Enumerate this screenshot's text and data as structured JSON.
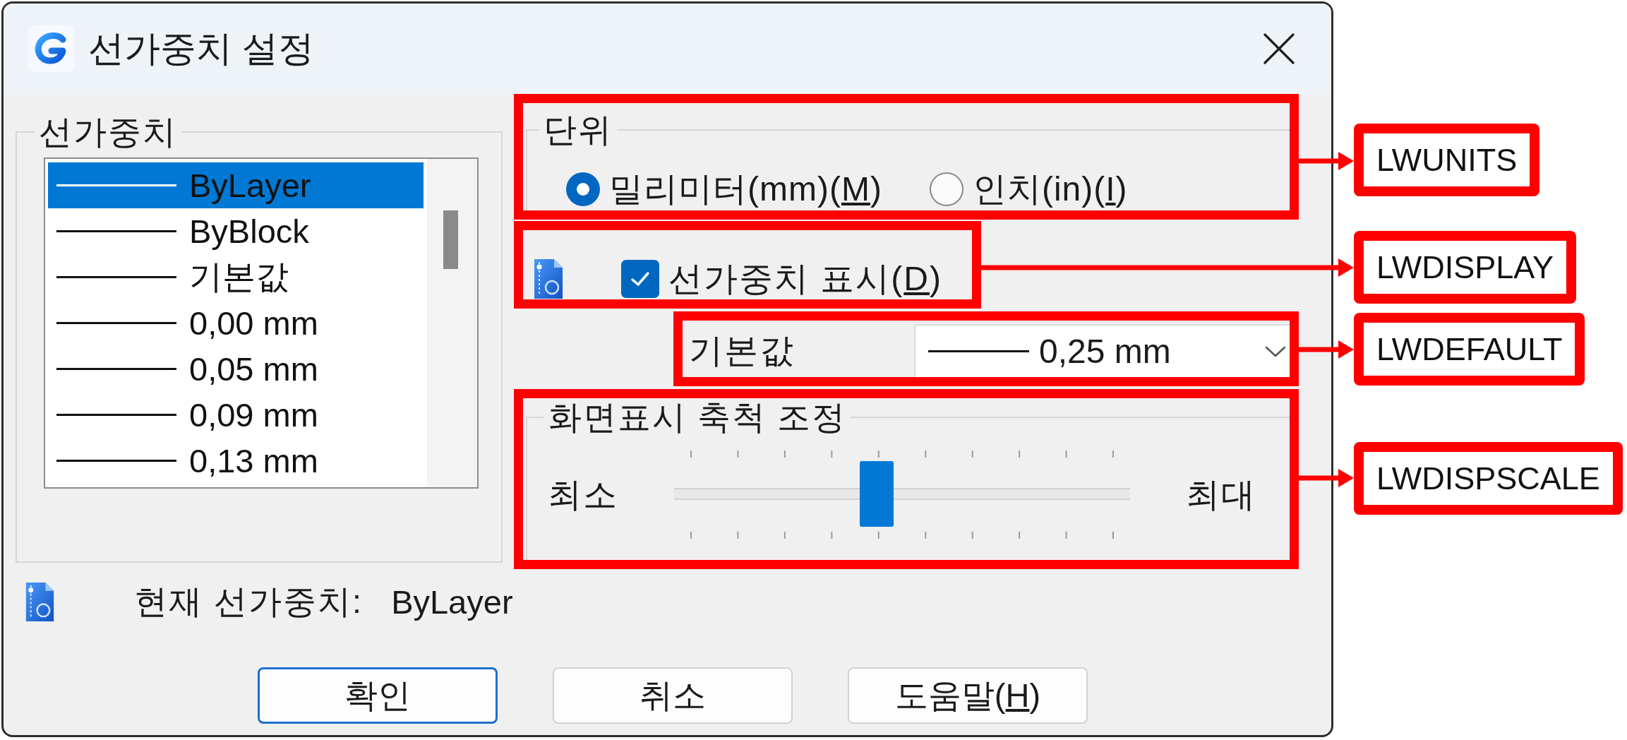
{
  "window": {
    "title": "선가중치 설정"
  },
  "lineweights": {
    "label": "선가중치",
    "items": [
      {
        "text": "ByLayer",
        "selected": true
      },
      {
        "text": "ByBlock",
        "selected": false
      },
      {
        "text": "기본값",
        "selected": false
      },
      {
        "text": "0,00 mm",
        "selected": false
      },
      {
        "text": "0,05 mm",
        "selected": false
      },
      {
        "text": "0,09 mm",
        "selected": false
      },
      {
        "text": "0,13 mm",
        "selected": false
      }
    ]
  },
  "units": {
    "label": "단위",
    "options": [
      {
        "label": {
          "text": "밀리미터(mm)(",
          "access_key": "M",
          "text_after": ")"
        },
        "selected": true
      },
      {
        "label": {
          "text": "인치(in)(",
          "access_key": "I",
          "text_after": ")"
        },
        "selected": false
      }
    ]
  },
  "display_lineweight": {
    "label": {
      "text": "선가중치 표시(",
      "access_key": "D",
      "text_after": ")"
    },
    "checked": true
  },
  "default_lineweight": {
    "label": "기본값",
    "value": "0,25 mm"
  },
  "display_scale": {
    "label": "화면표시 축척 조정",
    "min_label": "최소",
    "max_label": "최대",
    "level": 0.44
  },
  "current_lineweight": {
    "label": "현재 선가중치:",
    "value": "ByLayer"
  },
  "buttons": [
    {
      "label": {
        "text": "확인"
      },
      "default": true
    },
    {
      "label": {
        "text": "취소"
      },
      "default": false
    },
    {
      "label": {
        "text": "도움말(",
        "access_key": "H",
        "text_after": ")"
      },
      "default": false
    }
  ],
  "annotations": [
    {
      "label": "LWUNITS"
    },
    {
      "label": "LWDISPLAY"
    },
    {
      "label": "LWDEFAULT"
    },
    {
      "label": "LWDISPSCALE"
    }
  ]
}
